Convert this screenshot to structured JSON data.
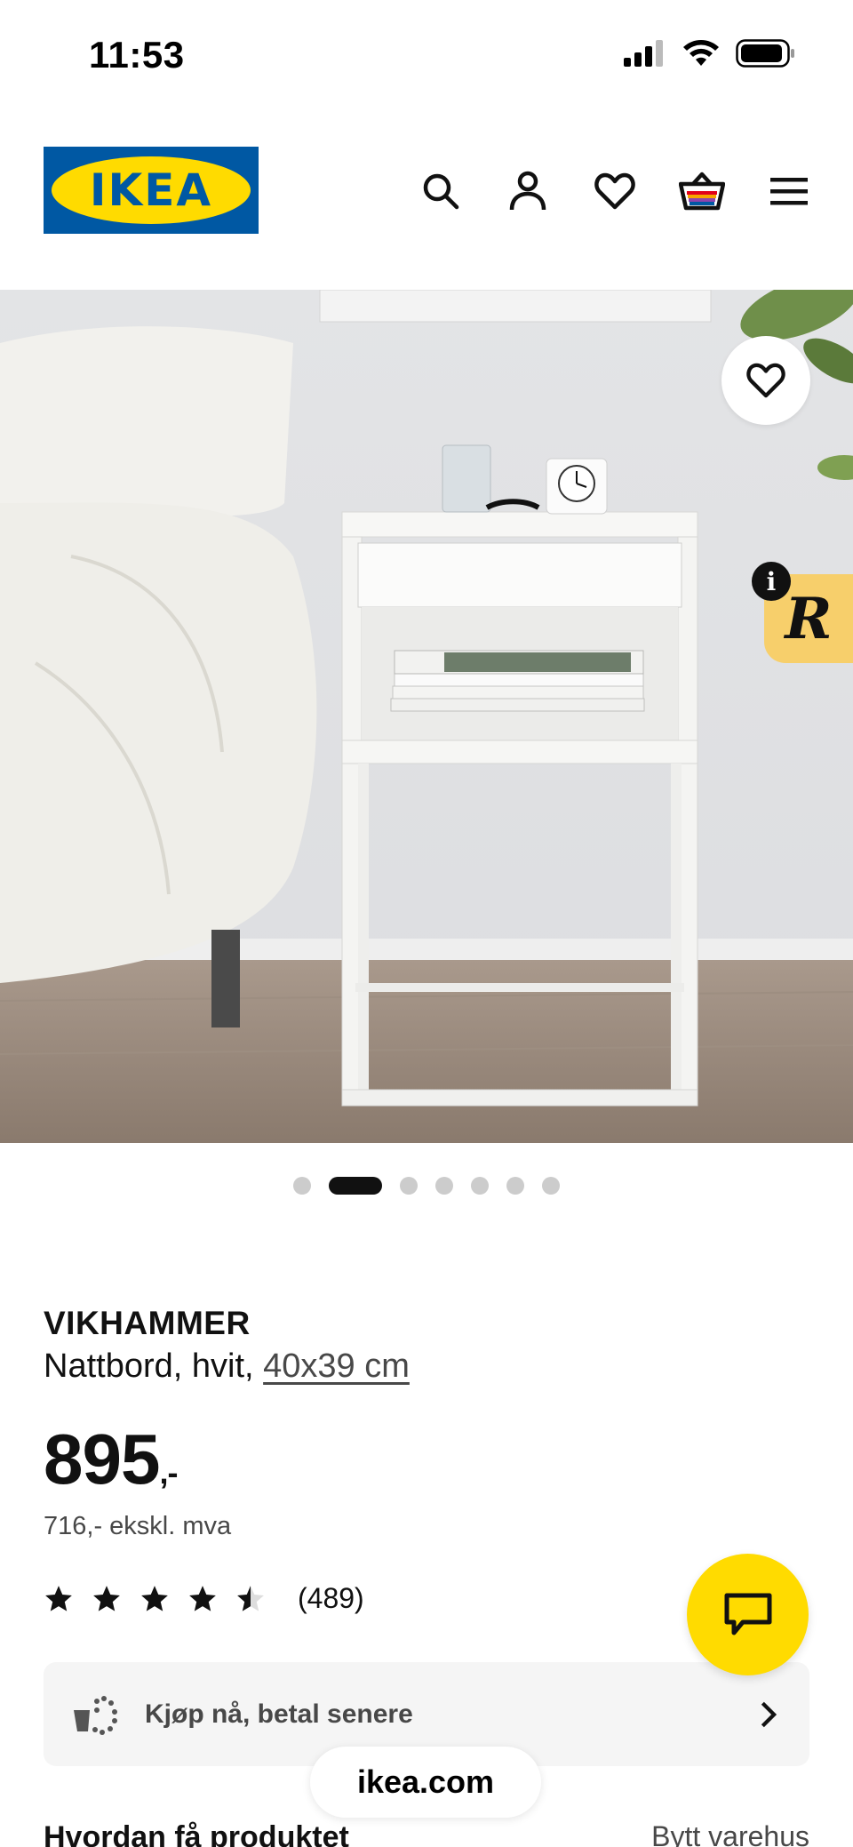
{
  "status_bar": {
    "time": "11:53"
  },
  "header": {
    "logo_text": "IKEA",
    "icons": [
      "search-icon",
      "account-icon",
      "heart-icon",
      "shopping-bag-icon",
      "menu-icon"
    ]
  },
  "hero": {
    "active_slide": 2,
    "slide_count": 7,
    "badge_text": "R",
    "info_text": "i"
  },
  "product": {
    "name": "VIKHAMMER",
    "description": "Nattbord, hvit, ",
    "size_link": "40x39 cm",
    "price": "895",
    "price_suffix": ",-",
    "price_ex_vat": "716,- ekskl. mva",
    "rating": 4.5,
    "rating_count": "(489)"
  },
  "payment": {
    "label": "Kjøp nå, betal senere"
  },
  "delivery": {
    "title": "Hvordan få produktet",
    "change_store": "Bytt varehus"
  },
  "browser": {
    "url": "ikea.com"
  },
  "colors": {
    "ikea_blue": "#0058a3",
    "ikea_yellow": "#ffdb00",
    "badge_yellow": "#f7cf6b"
  }
}
